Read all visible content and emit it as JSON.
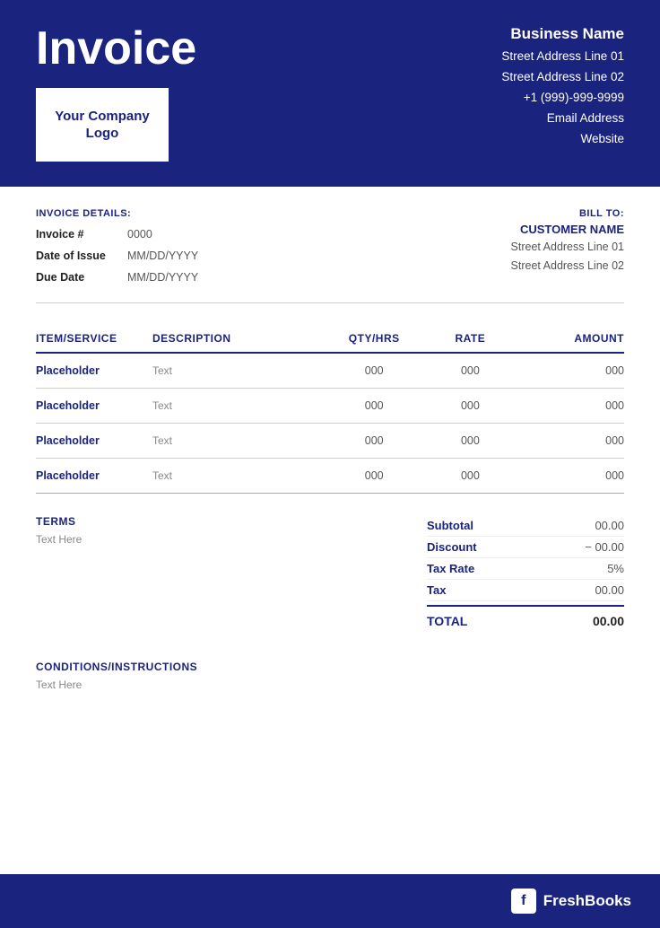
{
  "header": {
    "invoice_title": "Invoice",
    "logo_text": "Your Company Logo",
    "business_name": "Business Name",
    "address_line1": "Street Address Line 01",
    "address_line2": "Street Address Line 02",
    "phone": "+1 (999)-999-9999",
    "email": "Email Address",
    "website": "Website"
  },
  "invoice_details": {
    "section_label": "INVOICE DETAILS:",
    "rows": [
      {
        "key": "Invoice #",
        "value": "0000"
      },
      {
        "key": "Date of Issue",
        "value": "MM/DD/YYYY"
      },
      {
        "key": "Due Date",
        "value": "MM/DD/YYYY"
      }
    ]
  },
  "bill_to": {
    "label": "BILL TO:",
    "customer_name": "CUSTOMER NAME",
    "address_line1": "Street Address Line 01",
    "address_line2": "Street Address Line 02"
  },
  "table": {
    "headers": [
      "ITEM/SERVICE",
      "DESCRIPTION",
      "QTY/HRS",
      "RATE",
      "AMOUNT"
    ],
    "rows": [
      {
        "item": "Placeholder",
        "description": "Text",
        "qty": "000",
        "rate": "000",
        "amount": "000"
      },
      {
        "item": "Placeholder",
        "description": "Text",
        "qty": "000",
        "rate": "000",
        "amount": "000"
      },
      {
        "item": "Placeholder",
        "description": "Text",
        "qty": "000",
        "rate": "000",
        "amount": "000"
      },
      {
        "item": "Placeholder",
        "description": "Text",
        "qty": "000",
        "rate": "000",
        "amount": "000"
      }
    ]
  },
  "terms": {
    "title": "TERMS",
    "text": "Text Here"
  },
  "totals": {
    "subtotal_label": "Subtotal",
    "subtotal_value": "00.00",
    "discount_label": "Discount",
    "discount_value": "− 00.00",
    "taxrate_label": "Tax Rate",
    "taxrate_value": "5%",
    "tax_label": "Tax",
    "tax_value": "00.00",
    "total_label": "TOTAL",
    "total_value": "00.00"
  },
  "conditions": {
    "title": "CONDITIONS/INSTRUCTIONS",
    "text": "Text Here"
  },
  "footer": {
    "brand_letter": "f",
    "brand_name": "FreshBooks"
  }
}
